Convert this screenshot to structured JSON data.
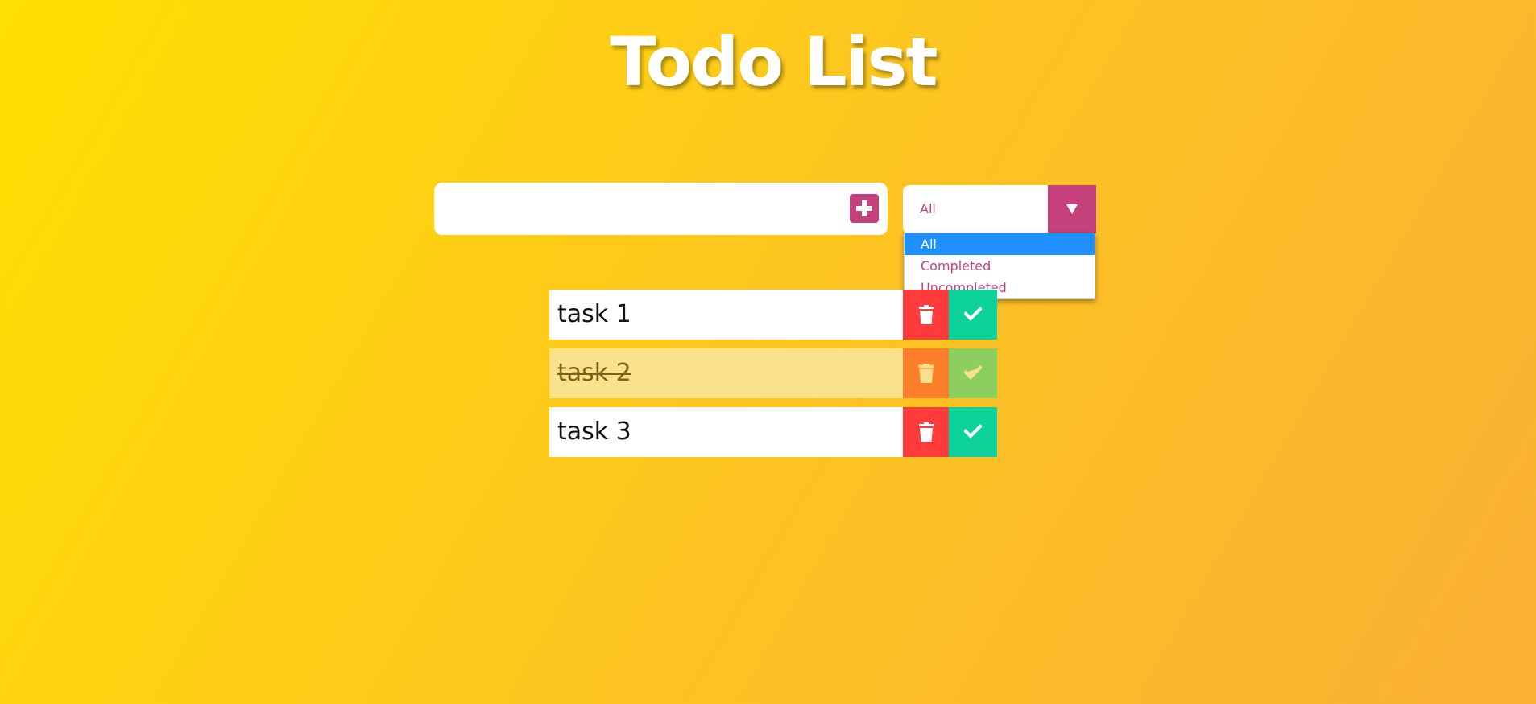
{
  "header": {
    "title": "Todo List"
  },
  "todo_input": {
    "value": "",
    "placeholder": ""
  },
  "filter": {
    "selected": "All",
    "options": [
      "All",
      "Completed",
      "Uncompleted"
    ]
  },
  "todos": [
    {
      "text": "task 1",
      "completed": false
    },
    {
      "text": "task 2",
      "completed": true
    },
    {
      "text": "task 3",
      "completed": false
    }
  ],
  "icons": {
    "add": "plus-square-icon",
    "filter_arrow": "caret-down-icon",
    "delete": "trash-icon",
    "complete": "check-icon"
  },
  "colors": {
    "accent": "#c5417c",
    "delete": "#ff3b3b",
    "complete": "#0dd39a",
    "selected_option": "#1e90ff"
  }
}
